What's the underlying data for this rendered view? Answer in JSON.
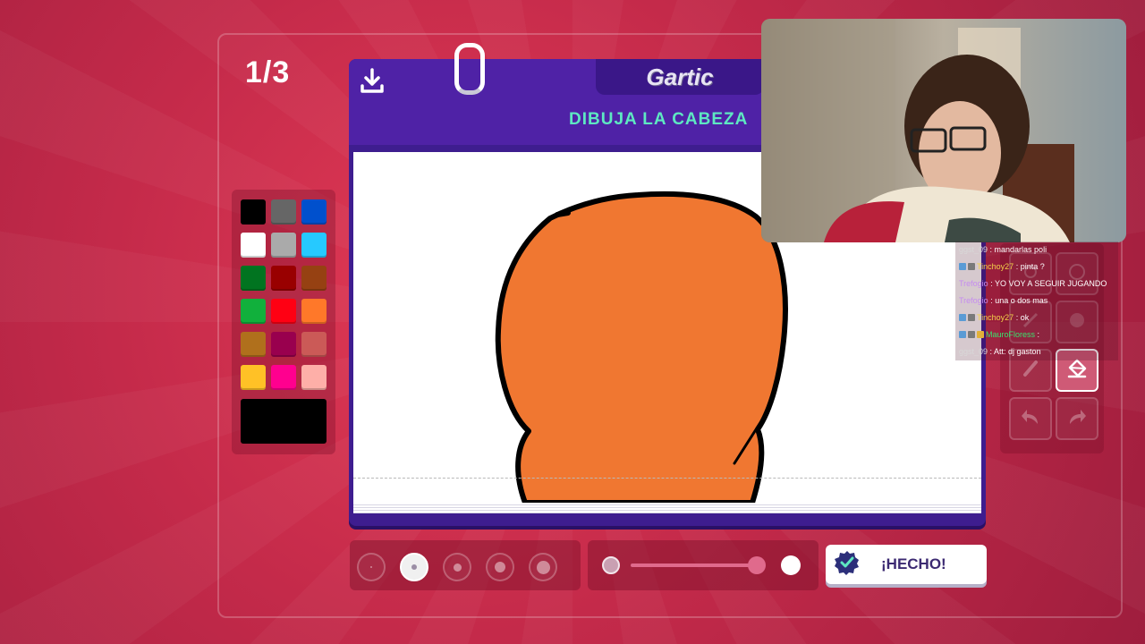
{
  "game": {
    "round_counter": "1/3",
    "logo": "Gartic",
    "prompt": "DIBUJA LA CABEZA",
    "done_label": "¡HECHO!"
  },
  "palette": {
    "colors": [
      "#000000",
      "#666666",
      "#0050cd",
      "#ffffff",
      "#aaaaaa",
      "#26c9ff",
      "#017420",
      "#990000",
      "#964112",
      "#11b03c",
      "#ff0013",
      "#ff7829",
      "#b0701c",
      "#99004e",
      "#cb5a57",
      "#ffc126",
      "#ff008f",
      "#feafa8"
    ],
    "current_color": "#000000"
  },
  "brush": {
    "sizes": [
      "size-1",
      "size-2",
      "size-3",
      "size-4",
      "size-5"
    ],
    "selected_size_index": 1,
    "opacity": 0.95
  },
  "chat": {
    "messages": [
      {
        "user": "ggst_09",
        "text": ": mandarlas poli",
        "badges": [],
        "user_color": "#d8d8d8"
      },
      {
        "user": "Tinchoy27",
        "text": ": pinta ?",
        "badges": [
          "blue",
          "alt"
        ],
        "user_color": "#f3d24a"
      },
      {
        "user": "Trefogio",
        "text": ": YO VOY A SEGUIR JUGANDO",
        "badges": [],
        "user_color": "#c58cf0"
      },
      {
        "user": "Trefogio",
        "text": ": una o dos mas",
        "badges": [],
        "user_color": "#c58cf0"
      },
      {
        "user": "Tinchoy27",
        "text": ": ok",
        "badges": [
          "blue",
          "alt"
        ],
        "user_color": "#f3d24a"
      },
      {
        "user": "MauroFloress",
        "text": ":",
        "badges": [
          "blue",
          "alt",
          "gold"
        ],
        "user_color": "#39e36e"
      },
      {
        "user": "ggst_09",
        "text": ": Att: dj gaston",
        "badges": [],
        "user_color": "#d8d8d8"
      }
    ]
  },
  "icons": {
    "download": "download-icon",
    "done": "check-badge-icon",
    "tools": [
      "pen-icon",
      "eraser-icon",
      "line-icon",
      "ellipse-icon",
      "brush-icon",
      "fill-bucket-icon",
      "undo-icon",
      "redo-icon"
    ]
  },
  "drawing": {
    "fill_color": "#f07731",
    "stroke_color": "#000000"
  }
}
